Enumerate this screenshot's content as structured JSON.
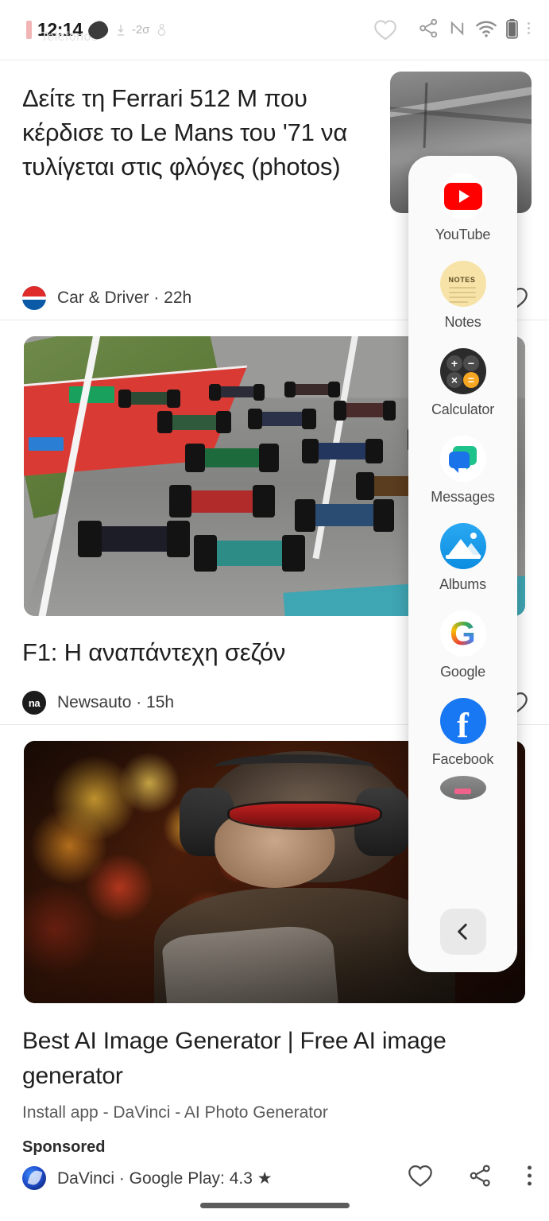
{
  "status_bar": {
    "clock": "12:14",
    "ghost_text": "Telefonos",
    "icons": [
      "heart-outline-icon",
      "share-icon",
      "nfc-icon",
      "wifi-icon",
      "battery-icon",
      "overflow-dots-icon"
    ]
  },
  "feed": {
    "articles": [
      {
        "id": "ferrari",
        "title": "Δείτε τη Ferrari 512 M που κέρδισε το Le Mans του '71 να τυλίγεται στις φλόγες (photos)",
        "source": "Car & Driver",
        "time": "22h",
        "meta": "Car & Driver · 22h",
        "thumbnail_alt": "vintage black and white racing photo"
      },
      {
        "id": "f1",
        "title": "F1: Η αναπάντεχη σεζόν",
        "source": "Newsauto",
        "time": "15h",
        "meta": "Newsauto · 15h",
        "logo_text": "na",
        "image_alt": "Formula 1 race start on track"
      },
      {
        "id": "davinci",
        "title": "Best AI Image Generator | Free AI image generator",
        "subtitle": "Install app - DaVinci - AI Photo Generator",
        "sponsored_label": "Sponsored",
        "meta": "DaVinci · Google Play: 4.3 ★",
        "source": "DaVinci",
        "rating": "4.3",
        "store": "Google Play",
        "image_alt": "AI generated gorilla with headphones and red sunglasses"
      }
    ]
  },
  "app_panel": {
    "apps": [
      {
        "label": "YouTube",
        "icon": "youtube-icon",
        "color": "#ff0000"
      },
      {
        "label": "Notes",
        "icon": "notes-icon",
        "color": "#f7e3a8",
        "badge_text": "NOTES"
      },
      {
        "label": "Calculator",
        "icon": "calculator-icon",
        "color": "#2b2b2b",
        "keys": [
          "+",
          "−",
          "×",
          "="
        ]
      },
      {
        "label": "Messages",
        "icon": "messages-icon",
        "color": "#1a73e8"
      },
      {
        "label": "Albums",
        "icon": "albums-icon",
        "color": "#0c8de0"
      },
      {
        "label": "Google",
        "icon": "google-icon",
        "color": "#4285f4",
        "glyph": "G"
      },
      {
        "label": "Facebook",
        "icon": "facebook-icon",
        "color": "#1877f2",
        "glyph": "f"
      }
    ],
    "back_button": "back-chevron-icon"
  },
  "colors": {
    "youtube_red": "#ff0000",
    "facebook_blue": "#1877f2",
    "messages_blue": "#1a73e8",
    "albums_blue": "#0c8de0",
    "calculator_orange": "#f5a623",
    "notes_cream": "#f7e3a8",
    "panel_bg": "#fafafa",
    "text_primary": "#1f1f1f",
    "text_secondary": "#5a5a5a"
  }
}
